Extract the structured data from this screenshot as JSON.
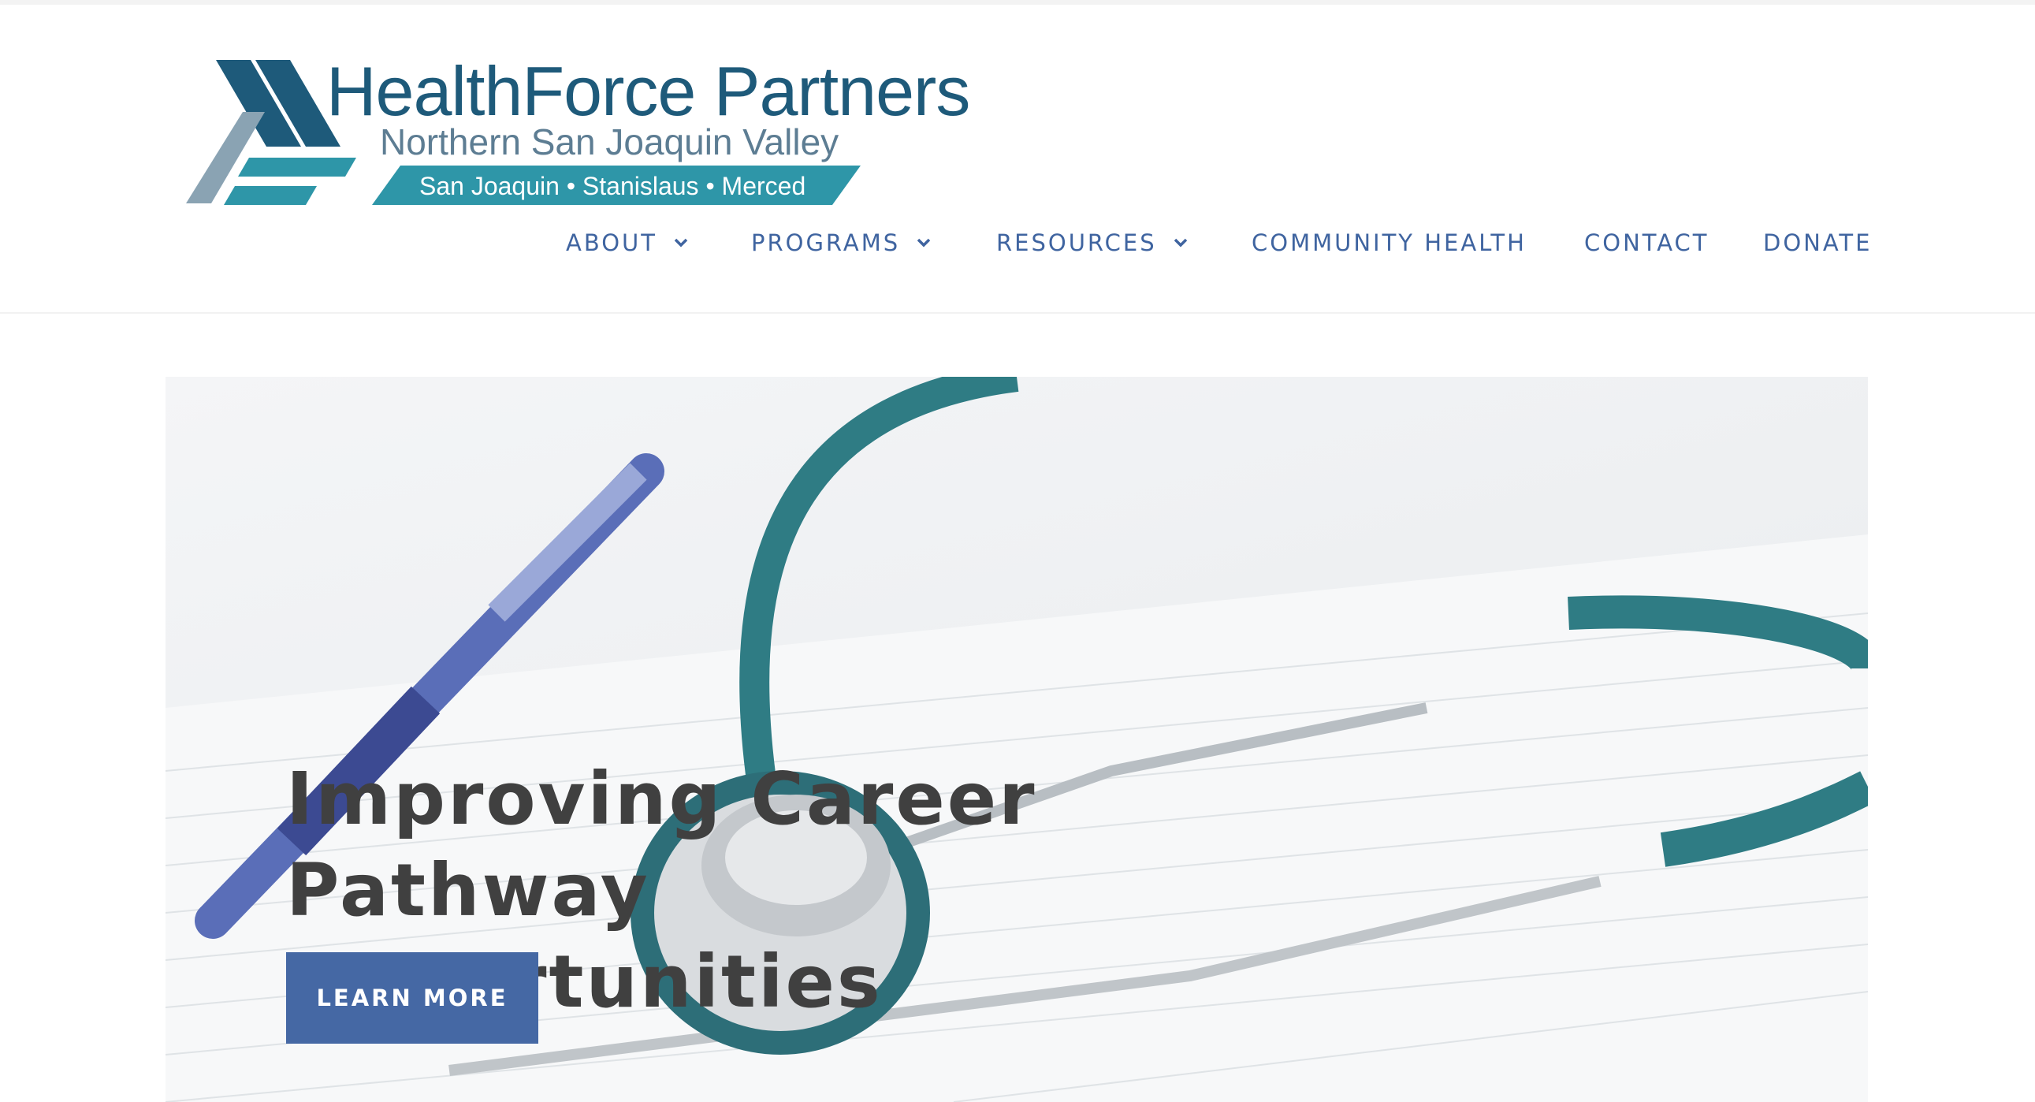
{
  "logo": {
    "title": "HealthForce Partners",
    "subtitle": "Northern San Joaquin Valley",
    "banner": "San Joaquin •  Stanislaus • Merced"
  },
  "nav": {
    "items": [
      {
        "label": "ABOUT",
        "dropdown": true
      },
      {
        "label": "PROGRAMS",
        "dropdown": true
      },
      {
        "label": "RESOURCES",
        "dropdown": true
      },
      {
        "label": "COMMUNITY HEALTH",
        "dropdown": false
      },
      {
        "label": "CONTACT",
        "dropdown": false
      },
      {
        "label": "DONATE",
        "dropdown": false
      }
    ]
  },
  "hero": {
    "title_line1": "Improving Career Pathway",
    "title_line2": "Opportunities",
    "button_label": "LEARN MORE",
    "image_icon": "stethoscope-on-chart-image"
  },
  "colors": {
    "nav_text": "#3f64a0",
    "logo_navy": "#1e5a7a",
    "logo_teal": "#2e96a8",
    "button_bg": "#4568a4",
    "hero_text": "#404040"
  }
}
